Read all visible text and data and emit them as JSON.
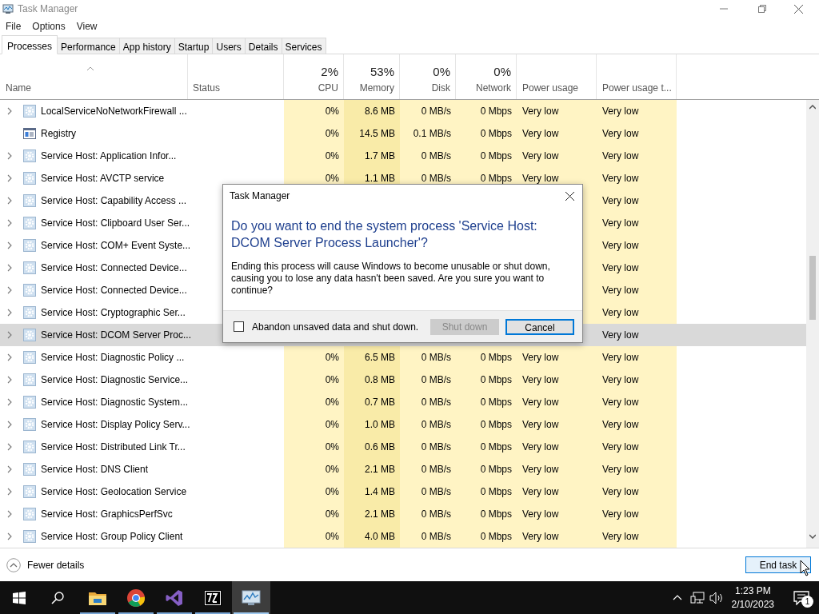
{
  "window": {
    "title": "Task Manager"
  },
  "menu": [
    "File",
    "Options",
    "View"
  ],
  "tabs": [
    {
      "label": "Processes",
      "selected": true
    },
    {
      "label": "Performance",
      "selected": false
    },
    {
      "label": "App history",
      "selected": false
    },
    {
      "label": "Startup",
      "selected": false
    },
    {
      "label": "Users",
      "selected": false
    },
    {
      "label": "Details",
      "selected": false
    },
    {
      "label": "Services",
      "selected": false
    }
  ],
  "table": {
    "columns": [
      {
        "label": "Name"
      },
      {
        "label": "Status"
      },
      {
        "percent": "2%",
        "label": "CPU"
      },
      {
        "percent": "53%",
        "label": "Memory"
      },
      {
        "percent": "0%",
        "label": "Disk"
      },
      {
        "percent": "0%",
        "label": "Network"
      },
      {
        "label": "Power usage"
      },
      {
        "label": "Power usage t..."
      }
    ],
    "rows": [
      {
        "kind": "service",
        "expandable": true,
        "selected": false,
        "name": "LocalServiceNoNetworkFirewall ...",
        "cpu": "0%",
        "memory": "8.6 MB",
        "disk": "0 MB/s",
        "network": "0 Mbps",
        "power": "Very low",
        "power_trend": "Very low"
      },
      {
        "kind": "app",
        "expandable": false,
        "selected": false,
        "name": "Registry",
        "cpu": "0%",
        "memory": "14.5 MB",
        "disk": "0.1 MB/s",
        "network": "0 Mbps",
        "power": "Very low",
        "power_trend": "Very low"
      },
      {
        "kind": "service",
        "expandable": true,
        "selected": false,
        "name": "Service Host: Application Infor...",
        "cpu": "0%",
        "memory": "1.7 MB",
        "disk": "0 MB/s",
        "network": "0 Mbps",
        "power": "Very low",
        "power_trend": "Very low"
      },
      {
        "kind": "service",
        "expandable": true,
        "selected": false,
        "name": "Service Host: AVCTP service",
        "cpu": "0%",
        "memory": "1.1 MB",
        "disk": "0 MB/s",
        "network": "0 Mbps",
        "power": "Very low",
        "power_trend": "Very low"
      },
      {
        "kind": "service",
        "expandable": true,
        "selected": false,
        "name": "Service Host: Capability Access ...",
        "power_trend": "Very low"
      },
      {
        "kind": "service",
        "expandable": true,
        "selected": false,
        "name": "Service Host: Clipboard User Ser...",
        "power_trend": "Very low"
      },
      {
        "kind": "service",
        "expandable": true,
        "selected": false,
        "name": "Service Host: COM+ Event Syste...",
        "power_trend": "Very low"
      },
      {
        "kind": "service",
        "expandable": true,
        "selected": false,
        "name": "Service Host: Connected Device...",
        "power_trend": "Very low"
      },
      {
        "kind": "service",
        "expandable": true,
        "selected": false,
        "name": "Service Host: Connected Device...",
        "power_trend": "Very low"
      },
      {
        "kind": "service",
        "expandable": true,
        "selected": false,
        "name": "Service Host: Cryptographic Ser...",
        "power_trend": "Very low"
      },
      {
        "kind": "service",
        "expandable": true,
        "selected": true,
        "name": "Service Host: DCOM Server Proc...",
        "power_trend": "Very low"
      },
      {
        "kind": "service",
        "expandable": true,
        "selected": false,
        "name": "Service Host: Diagnostic Policy ...",
        "cpu": "0%",
        "memory": "6.5 MB",
        "disk": "0 MB/s",
        "network": "0 Mbps",
        "power": "Very low",
        "power_trend": "Very low"
      },
      {
        "kind": "service",
        "expandable": true,
        "selected": false,
        "name": "Service Host: Diagnostic Service...",
        "cpu": "0%",
        "memory": "0.8 MB",
        "disk": "0 MB/s",
        "network": "0 Mbps",
        "power": "Very low",
        "power_trend": "Very low"
      },
      {
        "kind": "service",
        "expandable": true,
        "selected": false,
        "name": "Service Host: Diagnostic System...",
        "cpu": "0%",
        "memory": "0.7 MB",
        "disk": "0 MB/s",
        "network": "0 Mbps",
        "power": "Very low",
        "power_trend": "Very low"
      },
      {
        "kind": "service",
        "expandable": true,
        "selected": false,
        "name": "Service Host: Display Policy Serv...",
        "cpu": "0%",
        "memory": "1.0 MB",
        "disk": "0 MB/s",
        "network": "0 Mbps",
        "power": "Very low",
        "power_trend": "Very low"
      },
      {
        "kind": "service",
        "expandable": true,
        "selected": false,
        "name": "Service Host: Distributed Link Tr...",
        "cpu": "0%",
        "memory": "0.6 MB",
        "disk": "0 MB/s",
        "network": "0 Mbps",
        "power": "Very low",
        "power_trend": "Very low"
      },
      {
        "kind": "service",
        "expandable": true,
        "selected": false,
        "name": "Service Host: DNS Client",
        "cpu": "0%",
        "memory": "2.1 MB",
        "disk": "0 MB/s",
        "network": "0 Mbps",
        "power": "Very low",
        "power_trend": "Very low"
      },
      {
        "kind": "service",
        "expandable": true,
        "selected": false,
        "name": "Service Host: Geolocation Service",
        "cpu": "0%",
        "memory": "1.4 MB",
        "disk": "0 MB/s",
        "network": "0 Mbps",
        "power": "Very low",
        "power_trend": "Very low"
      },
      {
        "kind": "service",
        "expandable": true,
        "selected": false,
        "name": "Service Host: GraphicsPerfSvc",
        "cpu": "0%",
        "memory": "2.1 MB",
        "disk": "0 MB/s",
        "network": "0 Mbps",
        "power": "Very low",
        "power_trend": "Very low"
      },
      {
        "kind": "service",
        "expandable": true,
        "selected": false,
        "name": "Service Host: Group Policy Client",
        "cpu": "0%",
        "memory": "4.0 MB",
        "disk": "0 MB/s",
        "network": "0 Mbps",
        "power": "Very low",
        "power_trend": "Very low"
      }
    ]
  },
  "dialog": {
    "title": "Task Manager",
    "heading": "Do you want to end the system process 'Service Host: DCOM Server Process Launcher'?",
    "message": "Ending this process will cause Windows to become unusable or shut down, causing you to lose any data hasn't been saved. Are you sure you want to continue?",
    "checkbox": {
      "label": "Abandon unsaved data and shut down.",
      "checked": false
    },
    "buttons": [
      {
        "label": "Shut down",
        "disabled": true,
        "default": false
      },
      {
        "label": "Cancel",
        "disabled": false,
        "default": true
      }
    ]
  },
  "footer": {
    "details_toggle": "Fewer details",
    "end_task": "End task"
  },
  "taskbar": {
    "apps": [
      {
        "kind": "explorer",
        "active": false
      },
      {
        "kind": "chrome",
        "active": false
      },
      {
        "kind": "studio",
        "active": false
      },
      {
        "kind": "archiver",
        "active": false
      },
      {
        "kind": "taskmgr",
        "active": true
      }
    ],
    "time": "1:23 PM",
    "date": "2/10/2023",
    "notifications": "1"
  }
}
